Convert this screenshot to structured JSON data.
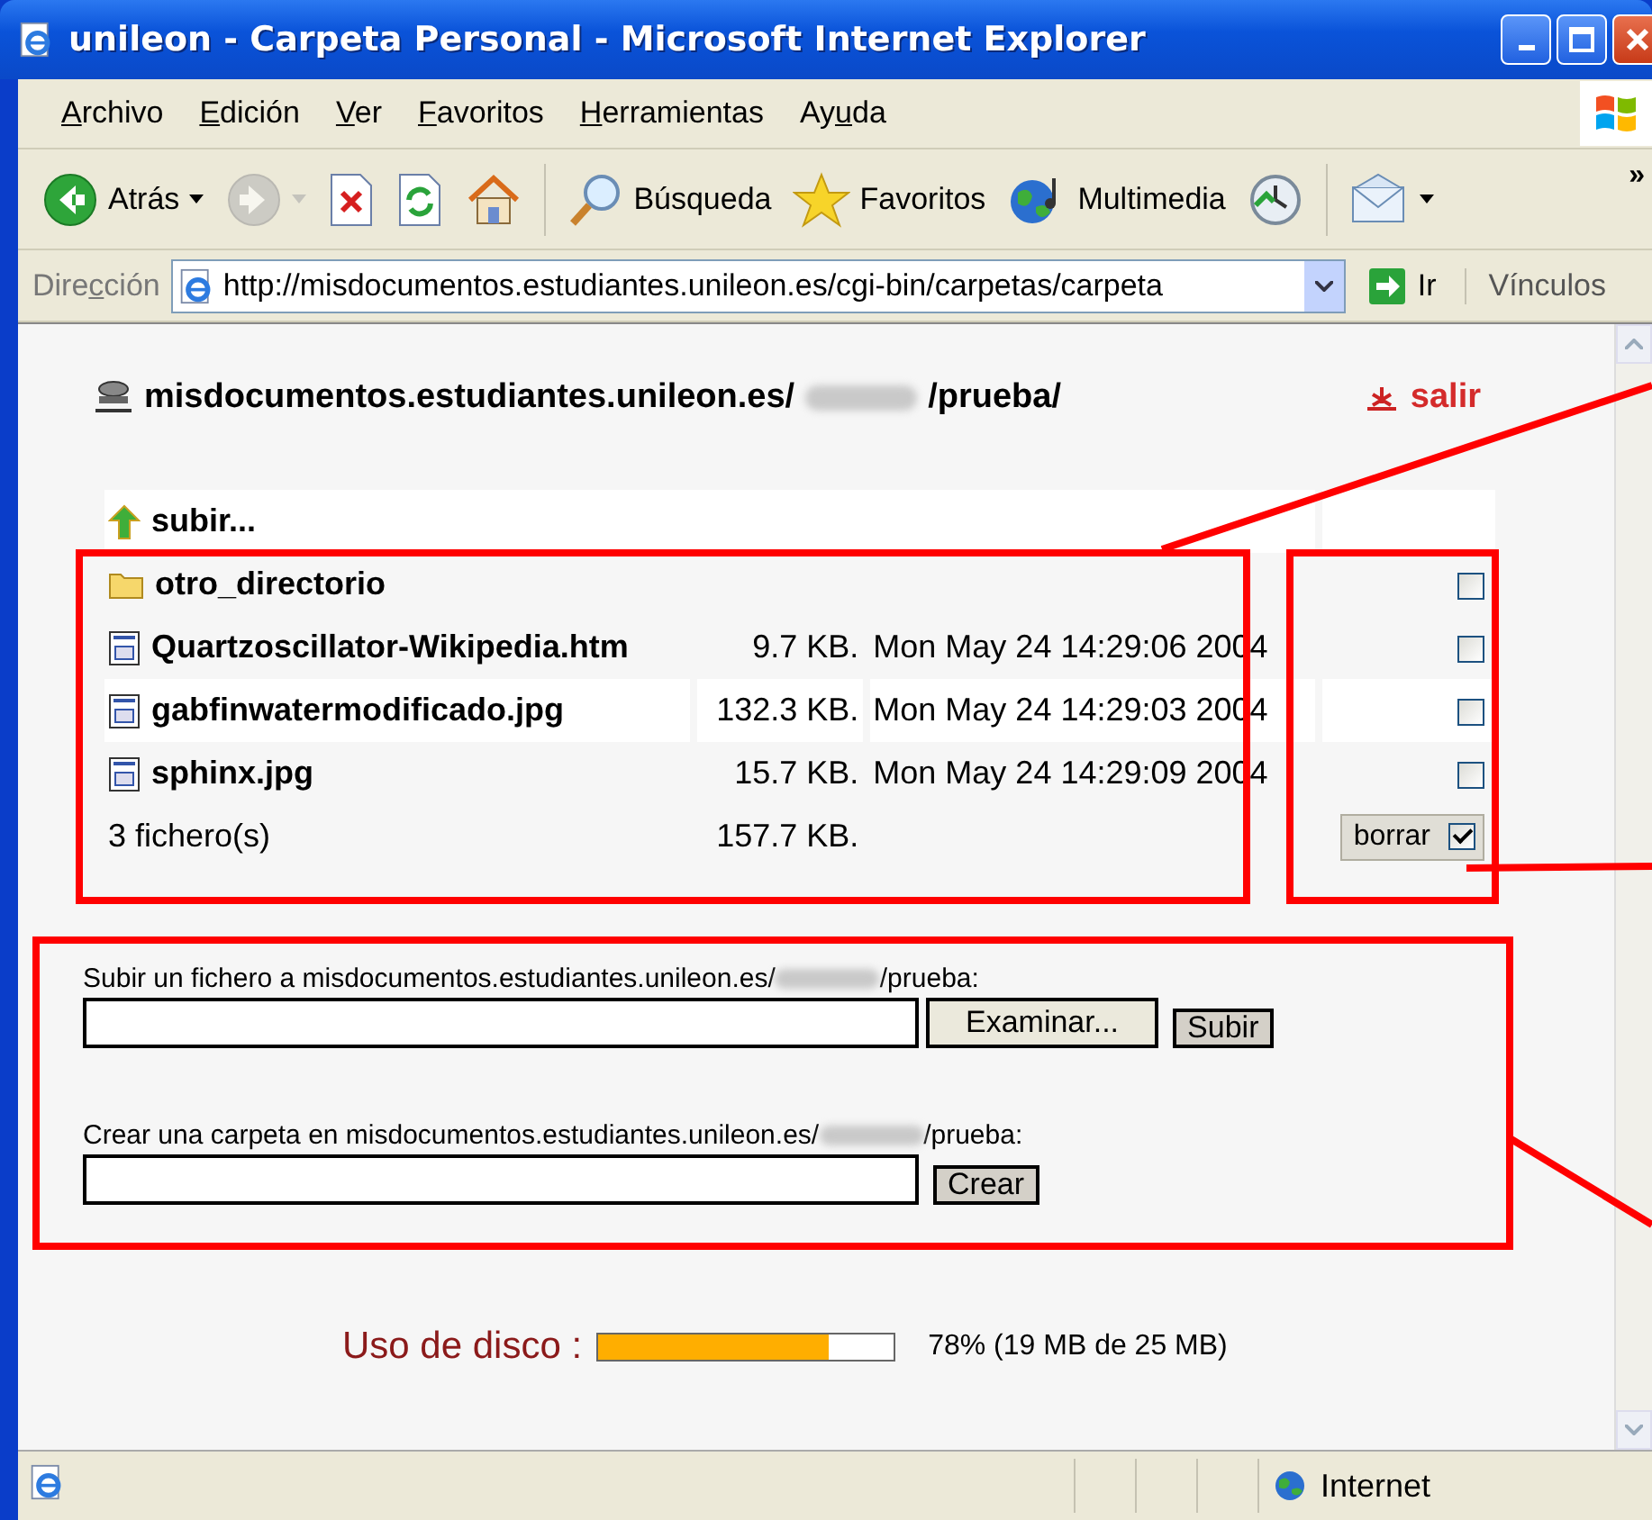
{
  "window": {
    "title": "unileon - Carpeta Personal - Microsoft Internet Explorer"
  },
  "menu": [
    {
      "key": "A",
      "post": "rchivo"
    },
    {
      "key": "E",
      "post": "dición"
    },
    {
      "key": "V",
      "post": "er"
    },
    {
      "key": "F",
      "post": "avoritos"
    },
    {
      "key": "H",
      "post": "erramientas"
    },
    {
      "pre": "Ay",
      "key": "u",
      "post": "da"
    }
  ],
  "toolbar": [
    {
      "kind": "back",
      "label": "Atrás",
      "disabled": false
    },
    {
      "kind": "forward",
      "disabled": true
    },
    {
      "kind": "stop",
      "disabled": false
    },
    {
      "kind": "refresh",
      "disabled": false
    },
    {
      "kind": "home",
      "disabled": false
    },
    {
      "kind": "search",
      "label": "Búsqueda",
      "disabled": false
    },
    {
      "kind": "favorites",
      "label": "Favoritos",
      "disabled": false
    },
    {
      "kind": "media",
      "label": "Multimedia",
      "disabled": false
    },
    {
      "kind": "history",
      "disabled": false
    },
    {
      "kind": "mail",
      "disabled": false
    }
  ],
  "toolbar_overflow": "»",
  "address_bar": {
    "label": {
      "pre": "Dire",
      "key": "c",
      "post": "ción"
    },
    "url": "http://misdocumentos.estudiantes.unileon.es/cgi-bin/carpetas/carpeta",
    "go": "Ir",
    "links": "Vínculos"
  },
  "page": {
    "host": "misdocumentos.estudiantes.unileon.es/",
    "path_end": "/prueba/",
    "logout": "salir",
    "up_link": "subir...",
    "files": [
      {
        "kind": "folder",
        "name": "otro_directorio",
        "checked": false
      },
      {
        "kind": "file",
        "name": "Quartzoscillator-Wikipedia.htm",
        "size": "9.7 KB.",
        "date": "Mon May 24 14:29:06 2004",
        "checked": false
      },
      {
        "kind": "file",
        "name": "gabfinwatermodificado.jpg",
        "size": "132.3 KB.",
        "date": "Mon May 24 14:29:03 2004",
        "checked": false
      },
      {
        "kind": "file",
        "name": "sphinx.jpg",
        "size": "15.7 KB.",
        "date": "Mon May 24 14:29:09 2004",
        "checked": false
      }
    ],
    "summary": {
      "count": "3 fichero(s)",
      "total": "157.7 KB."
    },
    "delete_button": {
      "label": "borrar",
      "checked": true
    },
    "upload": {
      "label_start": "Subir un fichero a misdocumentos.estudiantes.unileon.es/",
      "label_end": "/prueba:",
      "browse": "Examinar...",
      "submit": "Subir"
    },
    "mkdir": {
      "label_start": "Crear una carpeta en misdocumentos.estudiantes.unileon.es/",
      "label_end": "/prueba:",
      "submit": "Crear"
    },
    "disk": {
      "label": "Uso de disco :",
      "level": 0.78,
      "reading": "78% (19 MB de 25 MB)"
    }
  },
  "status_bar": {
    "zone": "Internet"
  }
}
